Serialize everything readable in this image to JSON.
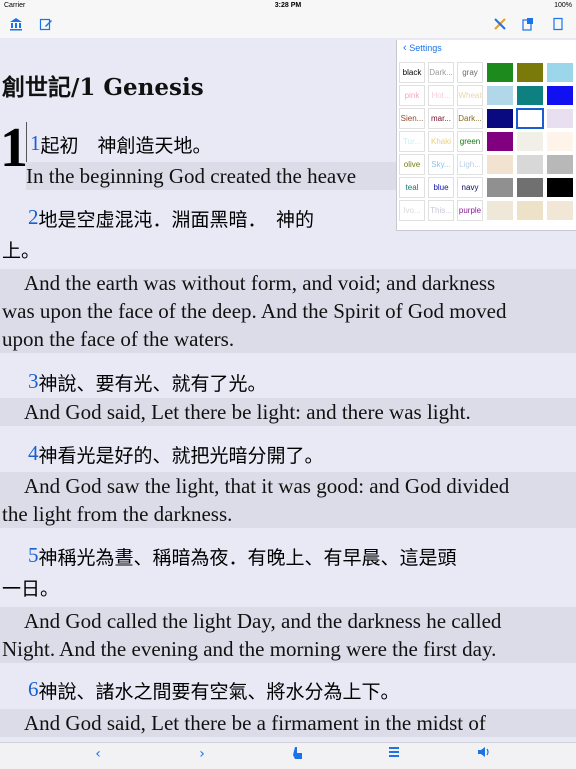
{
  "status": {
    "carrier": "Carrier",
    "time": "3:28 PM",
    "battery": "100%"
  },
  "toolbar": {
    "left_icons": [
      "library-icon",
      "edit-icon"
    ],
    "right_icons": [
      "tools-icon",
      "copy-icon",
      "page-icon"
    ]
  },
  "book": {
    "title": "創世記/1 Genesis",
    "chapter": "1"
  },
  "verses": [
    {
      "num": "1",
      "cn": "起初　神創造天地。",
      "en": "In the beginning God created the heave"
    },
    {
      "num": "2",
      "cn": "地是空虛混沌．淵面黑暗．　神的",
      "cn2": "上。",
      "en": [
        "And the earth was without form, and void; and darkness",
        "was upon the face of the deep. And the Spirit of God moved",
        "upon the face of the waters."
      ]
    },
    {
      "num": "3",
      "cn": "神說、要有光、就有了光。",
      "en": [
        "And God said, Let there be light: and there was light."
      ]
    },
    {
      "num": "4",
      "cn": "神看光是好的、就把光暗分開了。",
      "en": [
        "And God saw the light, that it was good: and God divided",
        "the light from the darkness."
      ]
    },
    {
      "num": "5",
      "cn": "神稱光為晝、稱暗為夜．有晚上、有早晨、這是頭",
      "cn2": "一日。",
      "en": [
        "And God called the light Day, and the darkness he called",
        "Night. And the evening and the morning were the first day."
      ]
    },
    {
      "num": "6",
      "cn": "神說、諸水之間要有空氣、將水分為上下。",
      "en": [
        "And God said, Let there be a firmament in the midst of"
      ]
    }
  ],
  "settings": {
    "back_label": "Settings",
    "text_swatches": [
      {
        "label": "black",
        "color": "#000000"
      },
      {
        "label": "Dark...",
        "color": "#9a9a9a"
      },
      {
        "label": "gray",
        "color": "#6b6b6b"
      },
      {
        "label": "pink",
        "color": "#f4a6c8"
      },
      {
        "label": "Hot...",
        "color": "#f7d0dc"
      },
      {
        "label": "Wheat",
        "color": "#e8d7a8"
      },
      {
        "label": "Sien...",
        "color": "#8b4a2a"
      },
      {
        "label": "mar...",
        "color": "#7a0a2a"
      },
      {
        "label": "Dark...",
        "color": "#8a6a1a"
      },
      {
        "label": "Tur...",
        "color": "#c8f0f0"
      },
      {
        "label": "Khaki",
        "color": "#e8d080"
      },
      {
        "label": "green",
        "color": "#117711"
      },
      {
        "label": "olive",
        "color": "#7a7a10"
      },
      {
        "label": "Sky...",
        "color": "#8ac8f0"
      },
      {
        "label": "Ligh...",
        "color": "#b8d0e8"
      },
      {
        "label": "teal",
        "color": "#117777"
      },
      {
        "label": "blue",
        "color": "#1111aa"
      },
      {
        "label": "navy",
        "color": "#0a0a66"
      },
      {
        "label": "Ivo...",
        "color": "#d8d8d8"
      },
      {
        "label": "This...",
        "color": "#c8c8d8"
      },
      {
        "label": "purple",
        "color": "#8a1a9a"
      }
    ],
    "color_swatches": [
      "#1c8a1c",
      "#7a7a0a",
      "#9cd6ea",
      "#b0d8e8",
      "#0f8080",
      "#1010f0",
      "#0a0a80",
      "#ffffff",
      "#e8e0f0",
      "#800080",
      "#f0f0e8",
      "#fff4ea",
      "#f2e2d0",
      "#d8d8d8",
      "#b8b8b8",
      "#909090",
      "#707070",
      "#000000",
      "#efe8d8",
      "#ede2c8",
      "#f2e6d6"
    ]
  },
  "bottombar": {
    "icons": [
      "chevron-left-icon",
      "chevron-right-icon",
      "hand-pointer-icon",
      "list-icon",
      "speaker-icon"
    ]
  }
}
